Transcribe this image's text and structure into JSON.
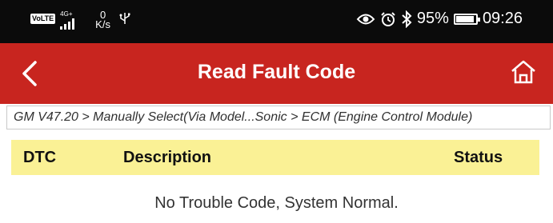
{
  "status_bar": {
    "volte": "VoLTE",
    "network_gen": "4G+",
    "network_type": "LTE",
    "speed_value": "0",
    "speed_unit": "K/s",
    "battery_percent": "95%",
    "time": "09:26"
  },
  "app_bar": {
    "title": "Read Fault Code",
    "accent_color": "#c8251f"
  },
  "breadcrumb": "GM V47.20 > Manually Select(Via Model...Sonic > ECM (Engine Control Module)",
  "table": {
    "header_color": "#faf195",
    "columns": [
      "DTC",
      "Description",
      "Status"
    ],
    "empty_message": "No Trouble Code, System Normal."
  }
}
